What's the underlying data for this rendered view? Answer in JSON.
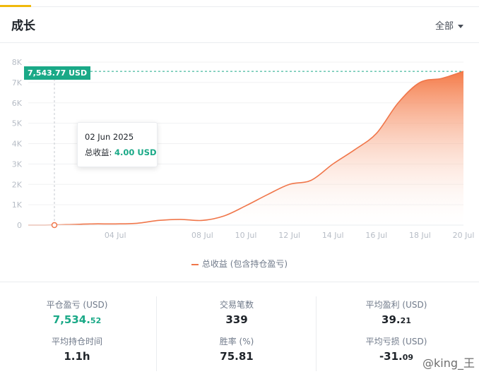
{
  "header": {
    "title": "成长",
    "filter_label": "全部"
  },
  "chart_data": {
    "type": "area",
    "y_ticks": [
      "0",
      "1K",
      "2K",
      "3K",
      "4K",
      "5K",
      "6K",
      "7K",
      "8K"
    ],
    "x_ticks": [
      "04 Jul",
      "08 Jul",
      "10 Jul",
      "12 Jul",
      "14 Jul",
      "16 Jul",
      "18 Jul",
      "20 Jul"
    ],
    "ylim": [
      0,
      8000
    ],
    "series": [
      {
        "name": "总收益 (包含持仓盈亏)",
        "color": "#f0764a",
        "x": [
          "2025-06-30",
          "2025-07-01",
          "2025-07-02",
          "2025-07-03",
          "2025-07-04",
          "2025-07-05",
          "2025-07-06",
          "2025-07-07",
          "2025-07-08",
          "2025-07-09",
          "2025-07-10",
          "2025-07-11",
          "2025-07-12",
          "2025-07-13",
          "2025-07-14",
          "2025-07-15",
          "2025-07-16",
          "2025-07-17",
          "2025-07-18",
          "2025-07-19",
          "2025-07-20"
        ],
        "values": [
          0,
          4,
          30,
          60,
          60,
          90,
          230,
          280,
          230,
          450,
          950,
          1500,
          2000,
          2200,
          3000,
          3700,
          4500,
          6000,
          7000,
          7200,
          7543.77
        ]
      }
    ],
    "current_value_label": "7,543.77 USD",
    "tooltip": {
      "date": "02 Jun 2025",
      "label": "总收益:",
      "value": "4.00 USD"
    }
  },
  "stats": {
    "closed_pnl_label": "平仓盈亏 (USD)",
    "closed_pnl_value_main": "7,534.",
    "closed_pnl_value_dec": "52",
    "trades_label": "交易笔数",
    "trades_value": "339",
    "avg_profit_label": "平均盈利 (USD)",
    "avg_profit_value_main": "39.",
    "avg_profit_value_dec": "21",
    "avg_hold_label": "平均持仓时间",
    "avg_hold_value": "1.1h",
    "win_rate_label": "胜率 (%)",
    "win_rate_value": "75.81",
    "avg_loss_label": "平均亏损 (USD)",
    "avg_loss_value_main": "-31.",
    "avg_loss_value_dec": "09"
  },
  "watermark": "@king_王"
}
